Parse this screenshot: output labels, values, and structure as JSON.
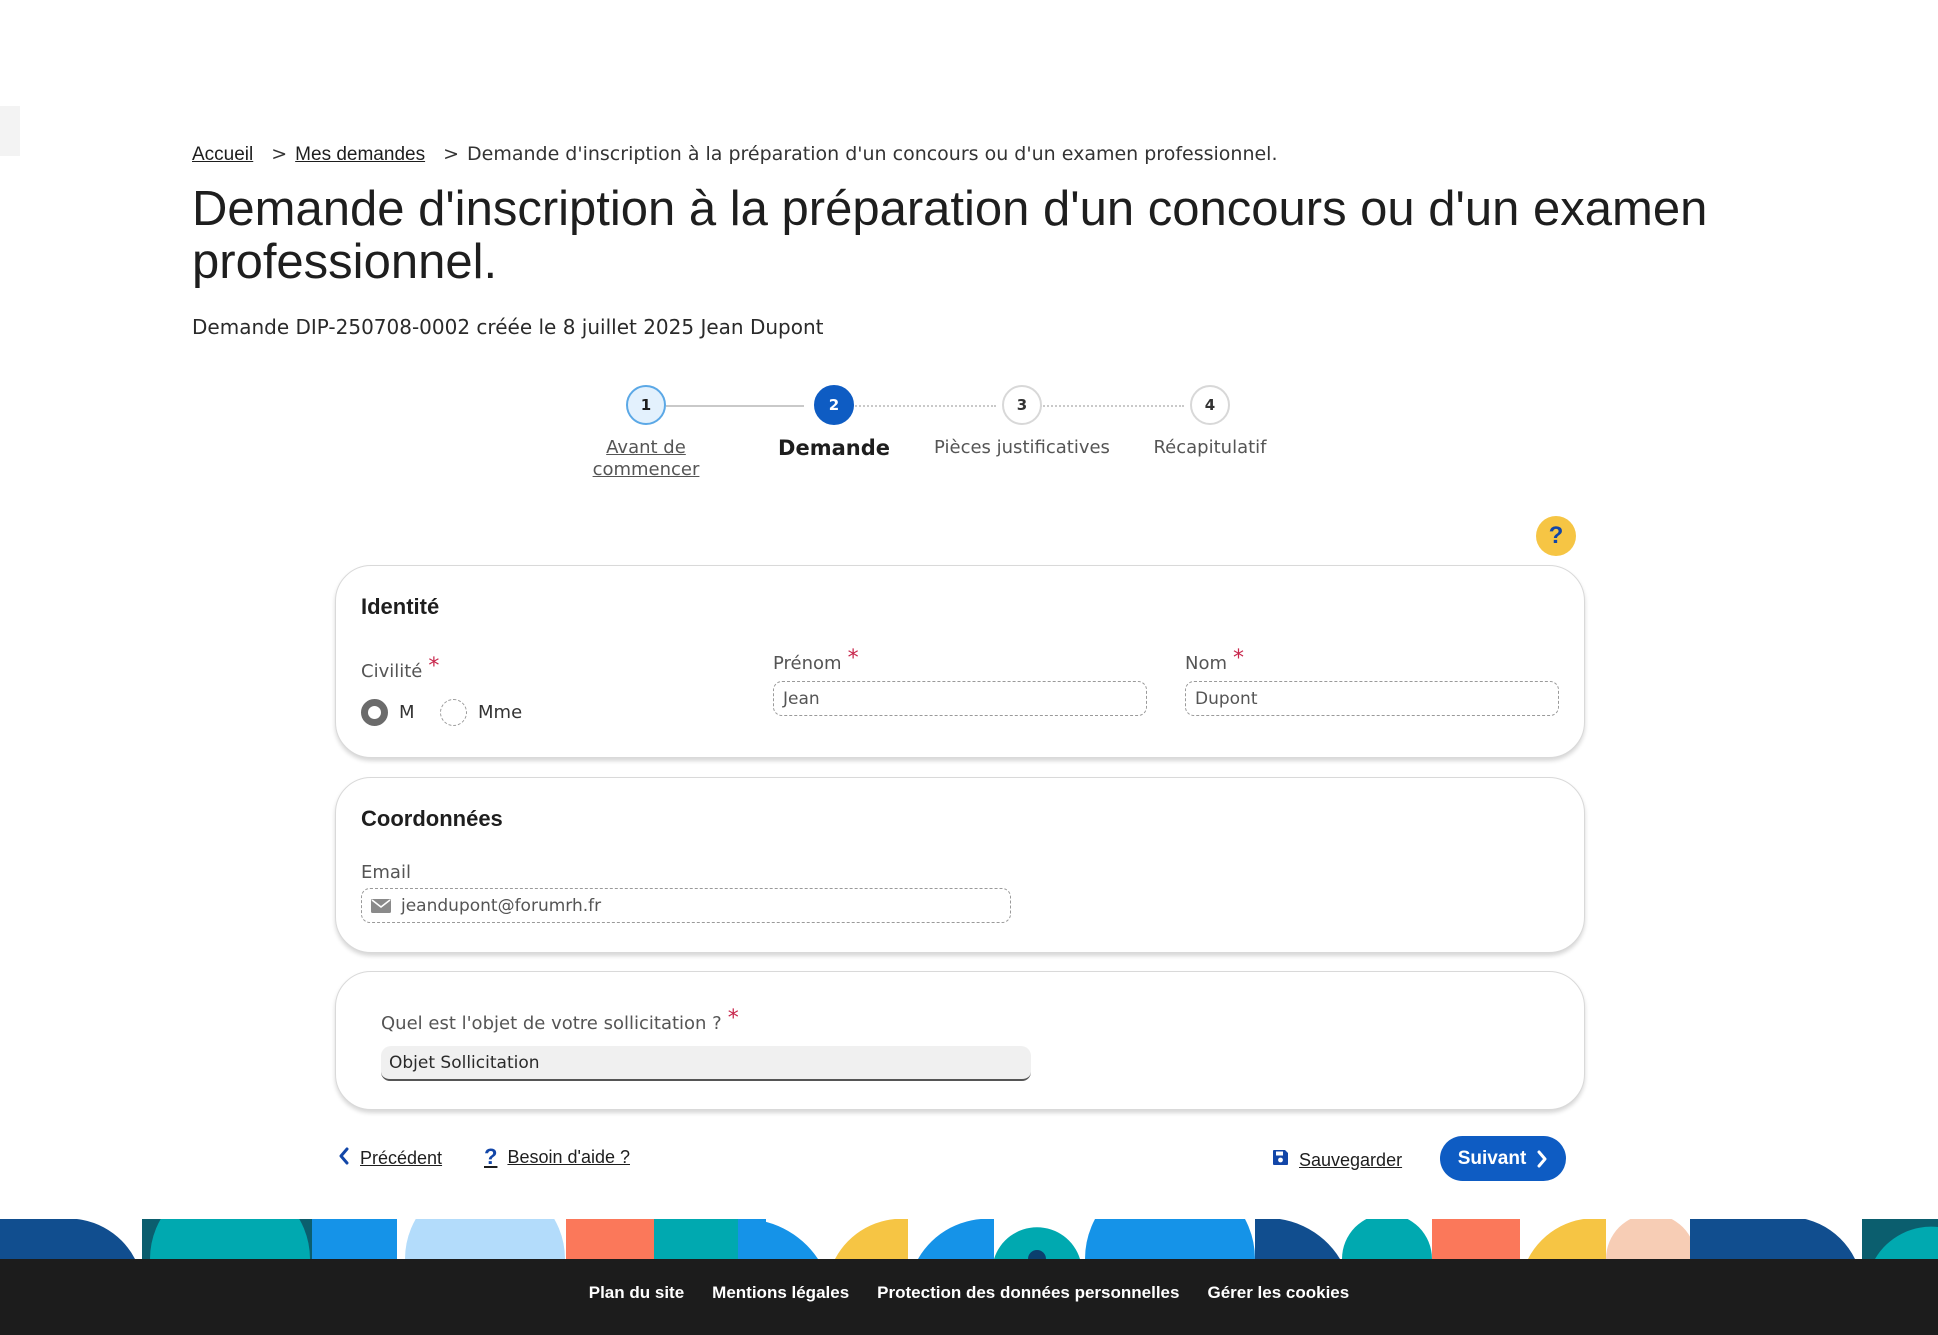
{
  "breadcrumb": {
    "home": "Accueil",
    "separator": ">",
    "requests": "Mes demandes",
    "current": "Demande d'inscription à la préparation d'un concours ou d'un examen professionnel."
  },
  "page": {
    "title": "Demande d'inscription à la préparation d'un concours ou d'un examen professionnel.",
    "meta": "Demande DIP-250708-0002 créée le 8 juillet 2025 Jean Dupont"
  },
  "stepper": {
    "steps": [
      {
        "number": "1",
        "label": "Avant de commencer",
        "state": "visited"
      },
      {
        "number": "2",
        "label": "Demande",
        "state": "active"
      },
      {
        "number": "3",
        "label": "Pièces justificatives",
        "state": "todo"
      },
      {
        "number": "4",
        "label": "Récapitulatif",
        "state": "todo"
      }
    ]
  },
  "help_bubble": "?",
  "identite": {
    "title": "Identité",
    "civilite_label": "Civilité",
    "required_mark": "*",
    "option_m": "M",
    "option_mme": "Mme",
    "selected": "M",
    "prenom_label": "Prénom",
    "prenom_value": "Jean",
    "nom_label": "Nom",
    "nom_value": "Dupont"
  },
  "coordonnees": {
    "title": "Coordonnées",
    "email_label": "Email",
    "email_value": "jeandupont@forumrh.fr"
  },
  "objet": {
    "question": "Quel est l'objet de votre sollicitation ?",
    "value": "Objet Sollicitation"
  },
  "actions": {
    "previous": "Précédent",
    "help": "Besoin d'aide ?",
    "save": "Sauvegarder",
    "next": "Suivant"
  },
  "footer": {
    "links": [
      "Plan du site",
      "Mentions légales",
      "Protection des données personnelles",
      "Gérer les cookies"
    ]
  },
  "colors": {
    "primary": "#0e5cc3",
    "accent_yellow": "#f6c544",
    "required": "#c8274c",
    "footer_bg": "#1c1c1c"
  }
}
